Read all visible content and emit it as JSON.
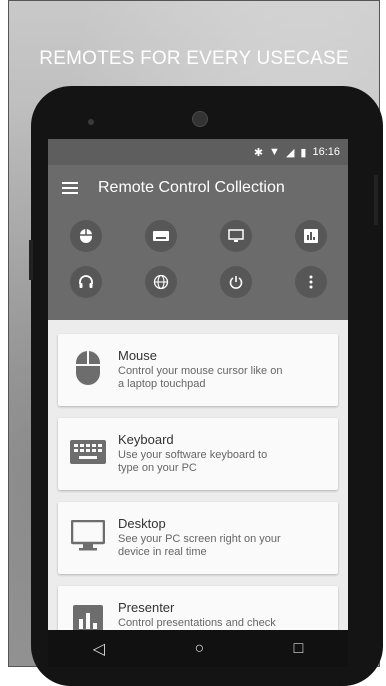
{
  "promo": {
    "heading": "REMOTES FOR EVERY USECASE"
  },
  "status": {
    "time": "16:16"
  },
  "app": {
    "title": "Remote Control Collection"
  },
  "grid": [
    {
      "icon": "mouse-icon"
    },
    {
      "icon": "keyboard-icon"
    },
    {
      "icon": "desktop-icon"
    },
    {
      "icon": "presenter-icon"
    },
    {
      "icon": "headphones-icon"
    },
    {
      "icon": "globe-icon"
    },
    {
      "icon": "power-icon"
    },
    {
      "icon": "more-vertical-icon"
    }
  ],
  "cards": [
    {
      "title": "Mouse",
      "desc": "Control your mouse cursor like on a laptop touchpad"
    },
    {
      "title": "Keyboard",
      "desc": "Use your software keyboard to type on your PC"
    },
    {
      "title": "Desktop",
      "desc": "See your PC screen right on your device in real time"
    },
    {
      "title": "Presenter",
      "desc": "Control presentations and check your slide content"
    }
  ],
  "nav": {
    "back": "◁",
    "home": "○",
    "recents": "□"
  }
}
